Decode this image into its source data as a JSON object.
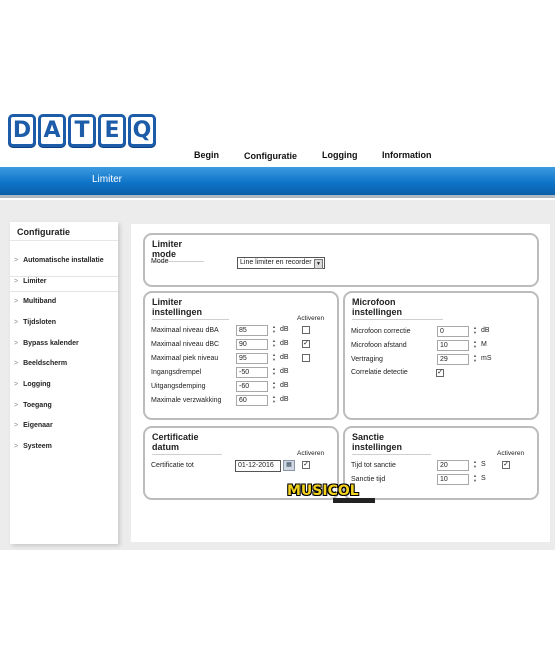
{
  "logo": {
    "letters": [
      "D",
      "A",
      "T",
      "E",
      "Q"
    ]
  },
  "nav": {
    "items": [
      "Begin",
      "Configuratie",
      "Logging",
      "Information"
    ],
    "active": "Configuratie"
  },
  "header": {
    "title": "Limiter"
  },
  "sidebar": {
    "title": "Configuratie",
    "items": [
      {
        "label": "Automatische installatie"
      },
      {
        "label": "Limiter",
        "active": true
      },
      {
        "label": "Multiband"
      },
      {
        "label": "Tijdsloten"
      },
      {
        "label": "Bypass kalender"
      },
      {
        "label": "Beeldscherm"
      },
      {
        "label": "Logging"
      },
      {
        "label": "Toegang"
      },
      {
        "label": "Eigenaar"
      },
      {
        "label": "Systeem"
      }
    ]
  },
  "limiter_mode": {
    "title": "Limiter mode",
    "mode_label": "Mode",
    "mode_value": "Line limiter en recorder"
  },
  "limiter_settings": {
    "title": "Limiter instellingen",
    "activate_header": "Activeren",
    "rows": [
      {
        "label": "Maximaal niveau dBA",
        "value": "85",
        "unit": "dB",
        "checkbox": true,
        "checked": false
      },
      {
        "label": "Maximaal niveau dBC",
        "value": "90",
        "unit": "dB",
        "checkbox": true,
        "checked": true
      },
      {
        "label": "Maximaal piek niveau",
        "value": "95",
        "unit": "dB",
        "checkbox": true,
        "checked": false
      },
      {
        "label": "Ingangsdrempel",
        "value": "-50",
        "unit": "dB",
        "checkbox": false
      },
      {
        "label": "Uitgangsdemping",
        "value": "-60",
        "unit": "dB",
        "checkbox": false
      },
      {
        "label": "Maximale verzwakking",
        "value": "60",
        "unit": "dB",
        "checkbox": false
      }
    ]
  },
  "microphone_settings": {
    "title": "Microfoon instellingen",
    "rows": [
      {
        "label": "Microfoon correctie",
        "value": "0",
        "unit": "dB"
      },
      {
        "label": "Microfoon afstand",
        "value": "10",
        "unit": "M"
      },
      {
        "label": "Vertraging",
        "value": "29",
        "unit": "mS"
      }
    ],
    "correlation_label": "Correlatie detectie",
    "correlation_checked": true
  },
  "certificate": {
    "title": "Certificatie datum",
    "activate_header": "Activeren",
    "label": "Certificatie tot",
    "date": "01-12-2016",
    "checked": true
  },
  "sanction": {
    "title": "Sanctie instellingen",
    "activate_header": "Activeren",
    "rows": [
      {
        "label": "Tijd tot sanctie",
        "value": "20",
        "unit": "S",
        "checkbox": true,
        "checked": true
      },
      {
        "label": "Sanctie tijd",
        "value": "10",
        "unit": "S",
        "checkbox": false
      }
    ]
  },
  "watermark": {
    "text": "MUSICOL"
  },
  "colors": {
    "band": "#0f74c8",
    "logo": "#1d5ca8"
  }
}
